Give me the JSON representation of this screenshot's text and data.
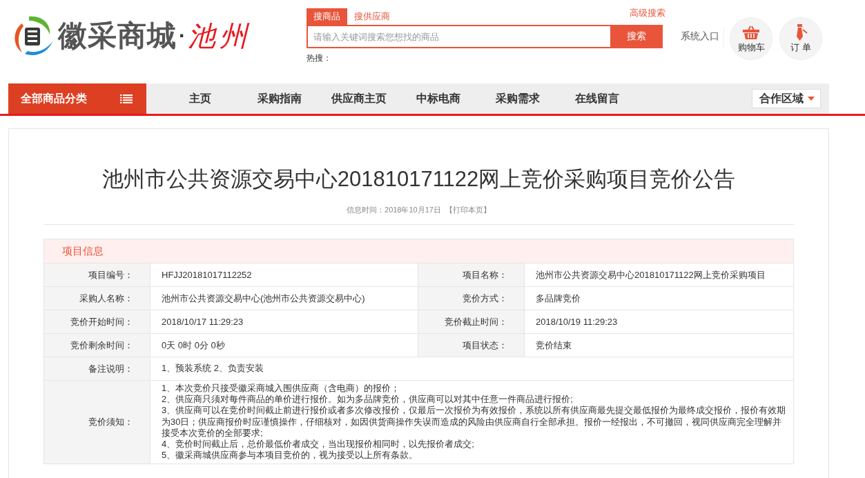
{
  "logo": {
    "name": "徽采商城",
    "separator": "·",
    "city": "池州"
  },
  "search": {
    "tabs": [
      {
        "label": "搜商品",
        "selected": true
      },
      {
        "label": "搜供应商",
        "selected": false
      }
    ],
    "advanced": "高级搜索",
    "placeholder": "请输入关键词搜索您想找的商品",
    "button": "搜索",
    "hot_label": "热搜："
  },
  "system_entry": "系统入口",
  "shortcuts": [
    {
      "kind": "cart",
      "label": "购物车"
    },
    {
      "kind": "order",
      "label": "订 单"
    }
  ],
  "nav": {
    "category_button": "全部商品分类",
    "items": [
      "主页",
      "采购指南",
      "供应商主页",
      "中标电商",
      "采购需求",
      "在线留言"
    ],
    "region": "合作区域"
  },
  "article": {
    "title": "池州市公共资源交易中心201810171122网上竞价采购项目竞价公告",
    "meta": "信息时间：2018年10月17日",
    "print": "【打印本页】",
    "section_title": "项目信息",
    "pair_rows": [
      [
        {
          "label": "项目编号：",
          "value": "HFJJ20181017112252"
        },
        {
          "label": "项目名称：",
          "value": "池州市公共资源交易中心201810171122网上竞价采购项目"
        }
      ],
      [
        {
          "label": "采购人名称：",
          "value": "池州市公共资源交易中心(池州市公共资源交易中心)"
        },
        {
          "label": "竞价方式：",
          "value": "多品牌竞价"
        }
      ],
      [
        {
          "label": "竞价开始时间：",
          "value": "2018/10/17 11:29:23"
        },
        {
          "label": "竞价截止时间：",
          "value": "2018/10/19 11:29:23"
        }
      ],
      [
        {
          "label": "竞价剩余时间：",
          "value": "0天 0时 0分 0秒"
        },
        {
          "label": "项目状态：",
          "value": "竞价结束"
        }
      ]
    ],
    "full_rows": [
      {
        "label": "备注说明：",
        "lines": [
          "1、预装系统 2、负责安装"
        ]
      },
      {
        "label": "竞价须知：",
        "lines": [
          "1、本次竞价只接受徽采商城入围供应商（含电商）的报价；",
          "2、供应商只须对每件商品的单价进行报价。如为多品牌竞价，供应商可以对其中任意一件商品进行报价;",
          "3、供应商可以在竞价时间截止前进行报价或者多次修改报价，仅最后一次报价为有效报价，系统以所有供应商最先提交最低报价为最终成交报价，报价有效期为30日；供应商报价时应谨慎操作，仔细核对，如因供货商操作失误而造成的风险由供应商自行全部承担。报价一经报出，不可撤回，视同供应商完全理解并接受本次竞价的全部要求;",
          "4、竞价时间截止后，总价最低价者成交，当出现报价相同时，以先报价者成交;",
          "5、徽采商城供应商参与本项目竞价的，视为接受以上所有条款。"
        ]
      }
    ]
  }
}
